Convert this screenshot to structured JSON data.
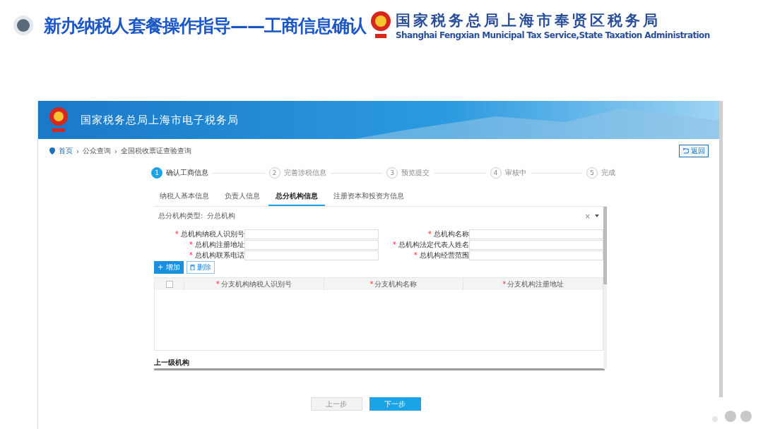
{
  "slide": {
    "title": "新办纳税人套餐操作指导——工商信息确认",
    "org_name": "国家税务总局上海市奉贤区税务局",
    "org_english": "Shanghai Fengxian Municipal Tax Service,State Taxation  Administration"
  },
  "portal": {
    "title": "国家税务总局上海市电子税务局",
    "breadcrumb": [
      {
        "text": "首页",
        "kind": "link"
      },
      {
        "text": "›",
        "kind": "separator"
      },
      {
        "text": "公众查询",
        "kind": "link"
      },
      {
        "text": "›",
        "kind": "separator"
      },
      {
        "text": "全国税收票证查验查询",
        "kind": "link"
      }
    ],
    "back_button": "返回",
    "steps": [
      {
        "number": "1",
        "label": "确认工商信息",
        "selected": true
      },
      {
        "number": "2",
        "label": "完善涉税信息",
        "selected": false
      },
      {
        "number": "3",
        "label": "预览提交",
        "selected": false
      },
      {
        "number": "4",
        "label": "审核中",
        "selected": false
      },
      {
        "number": "5",
        "label": "完成",
        "selected": false
      }
    ],
    "tabs": [
      {
        "label": "纳税人基本信息",
        "selected": false
      },
      {
        "label": "负责人信息",
        "selected": false
      },
      {
        "label": "总分机构信息",
        "selected": true
      },
      {
        "label": "注册资本和投资方信息",
        "selected": false
      }
    ],
    "type_label": "总分机构类型:",
    "type_value": "分总机构",
    "type_clear": "×",
    "fields": [
      {
        "mark": "*",
        "label": "总机构纳税人识别号"
      },
      {
        "mark": "*",
        "label": "总机构名称"
      },
      {
        "mark": "*",
        "label": "总机构注册地址"
      },
      {
        "mark": "*",
        "label": "总机构法定代表人姓名"
      },
      {
        "mark": "*",
        "label": "总机构联系电话"
      },
      {
        "mark": "*",
        "label": "总机构经营范围"
      }
    ],
    "add_button": "+ 增加",
    "delete_button": "删除",
    "select_all_checked": false,
    "columns": [
      {
        "mark": "*",
        "label": "分支机构纳税人识别号"
      },
      {
        "mark": "*",
        "label": "分支机构名称"
      },
      {
        "mark": "*",
        "label": "分支机构注册地址"
      }
    ],
    "section": "上一级机构",
    "prev_button": {
      "label": "上一步",
      "disabled": true
    },
    "next_button": {
      "label": "下一步",
      "disabled": false
    }
  }
}
